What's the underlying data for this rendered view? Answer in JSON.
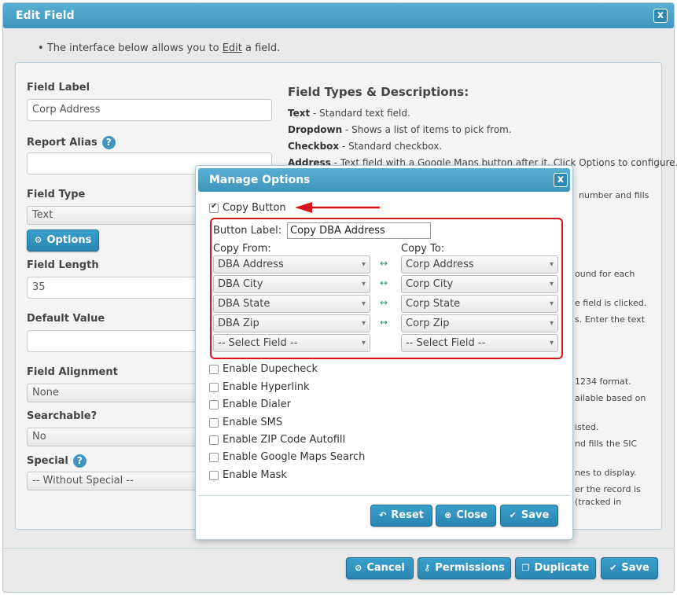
{
  "window": {
    "title": "Edit Field",
    "close": "x"
  },
  "intro": {
    "prefix": "The interface below allows you to ",
    "link": "Edit",
    "suffix": " a field."
  },
  "form": {
    "field_label": {
      "label": "Field Label",
      "value": "Corp Address"
    },
    "report_alias": {
      "label": "Report Alias",
      "help": "?",
      "value": ""
    },
    "field_type": {
      "label": "Field Type",
      "value": "Text"
    },
    "options_button": "Options",
    "field_length": {
      "label": "Field Length",
      "value": "35"
    },
    "default_value": {
      "label": "Default Value",
      "value": ""
    },
    "field_alignment": {
      "label": "Field Alignment",
      "value": "None"
    },
    "searchable": {
      "label": "Searchable?",
      "value": "No"
    },
    "special": {
      "label": "Special",
      "help": "?",
      "value": "-- Without Special --"
    }
  },
  "descriptions": {
    "heading": "Field Types & Descriptions:",
    "items": [
      {
        "name": "Text",
        "text": " - Standard text field."
      },
      {
        "name": "Dropdown",
        "text": " - Shows a list of items to pick from."
      },
      {
        "name": "Checkbox",
        "text": " - Standard checkbox."
      },
      {
        "name": "Address",
        "text": " - Text field with a Google Maps button after it. Click Options to configure."
      }
    ],
    "fragments": [
      "number and fills",
      "ound for each",
      "e field is clicked.",
      "s. Enter the text",
      "1234 format.",
      "ailable based on",
      "isted.",
      "nd fills the SIC",
      "nes to display.",
      "er the record is",
      "(tracked in"
    ]
  },
  "footer_buttons": {
    "cancel": "Cancel",
    "permissions": "Permissions",
    "duplicate": "Duplicate",
    "save": "Save"
  },
  "modal": {
    "title": "Manage Options",
    "close": "x",
    "copy_button": {
      "label": "Copy Button",
      "checked": true
    },
    "button_label": {
      "label": "Button Label:",
      "value": "Copy DBA Address"
    },
    "copy_from_label": "Copy From:",
    "copy_to_label": "Copy To:",
    "mapping_arrow": "↔",
    "mappings": [
      {
        "from": "DBA Address",
        "to": "Corp Address"
      },
      {
        "from": "DBA City",
        "to": "Corp City"
      },
      {
        "from": "DBA State",
        "to": "Corp State"
      },
      {
        "from": "DBA Zip",
        "to": "Corp Zip"
      },
      {
        "from": "-- Select Field --",
        "to": "-- Select Field --"
      }
    ],
    "checkboxes": [
      "Enable Dupecheck",
      "Enable Hyperlink",
      "Enable Dialer",
      "Enable SMS",
      "Enable ZIP Code Autofill",
      "Enable Google Maps Search",
      "Enable Mask"
    ],
    "buttons": {
      "reset": "Reset",
      "close": "Close",
      "save": "Save"
    }
  },
  "colors": {
    "accent": "#3f95be",
    "highlight": "#d9141b"
  }
}
